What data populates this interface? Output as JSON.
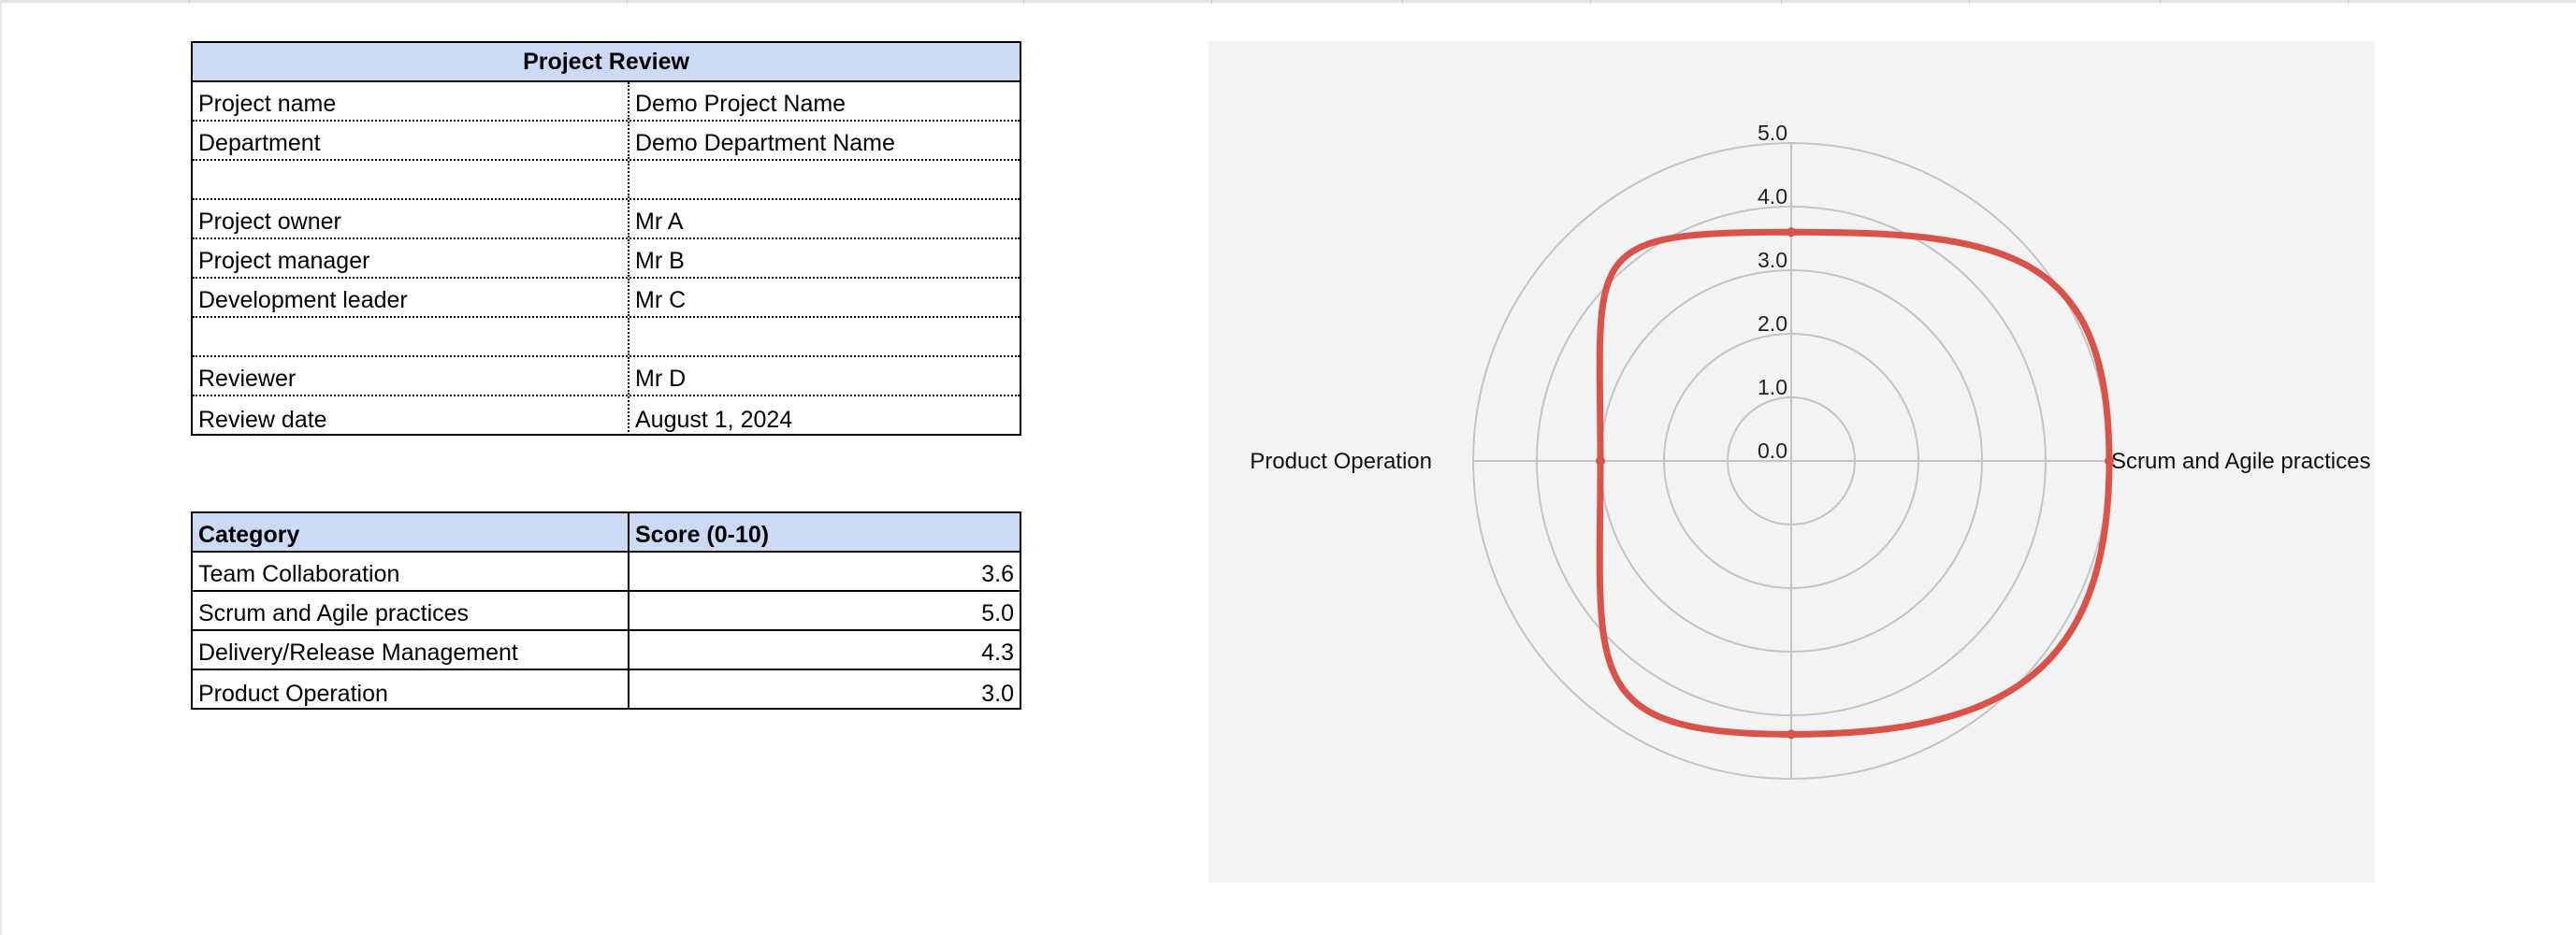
{
  "project_review": {
    "title": "Project Review",
    "rows": [
      {
        "label": "Project name",
        "value": "Demo Project Name"
      },
      {
        "label": "Department",
        "value": "Demo Department Name"
      },
      {
        "label": "",
        "value": ""
      },
      {
        "label": "Project owner",
        "value": "Mr A"
      },
      {
        "label": "Project manager",
        "value": "Mr B"
      },
      {
        "label": "Development leader",
        "value": "Mr C"
      },
      {
        "label": "",
        "value": ""
      },
      {
        "label": "Reviewer",
        "value": "Mr D"
      },
      {
        "label": "Review date",
        "value": "August 1, 2024"
      }
    ]
  },
  "score_table": {
    "headers": [
      "Category",
      "Score (0-10)"
    ],
    "rows": [
      {
        "category": "Team Collaboration",
        "score": "3.6"
      },
      {
        "category": "Scrum and Agile practices",
        "score": "5.0"
      },
      {
        "category": "Delivery/Release Management",
        "score": "4.3"
      },
      {
        "category": "Product Operation",
        "score": "3.0"
      }
    ]
  },
  "colors": {
    "header_fill": "#ccdaf5",
    "chart_background": "#f3f3f3",
    "series_line": "#d9534a",
    "grid_line": "#c4c4c4"
  },
  "chart_data": {
    "type": "radar",
    "categories": [
      "Team Collaboration",
      "Scrum and Agile practices",
      "Delivery/Release Management",
      "Product Operation"
    ],
    "visible_axis_labels": [
      "",
      "Scrum and Agile practices",
      "",
      "Product Operation"
    ],
    "series": [
      {
        "values": [
          3.6,
          5.0,
          4.3,
          3.0
        ]
      }
    ],
    "rlim": [
      0,
      5
    ],
    "tick_labels": [
      "0.0",
      "1.0",
      "2.0",
      "3.0",
      "4.0",
      "5.0"
    ],
    "grid": true,
    "legend": "none",
    "smooth": true
  }
}
